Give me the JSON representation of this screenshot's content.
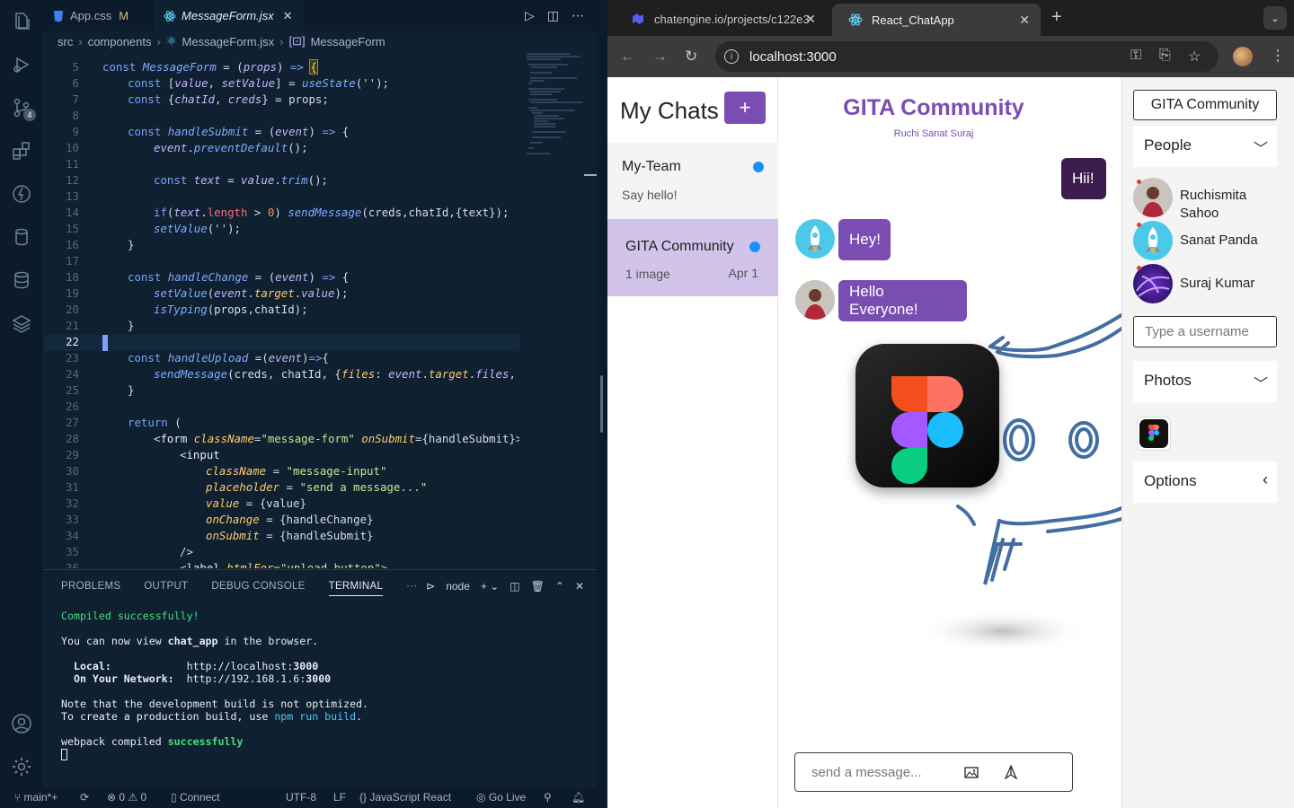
{
  "vscode": {
    "tabs": [
      {
        "label": "App.css",
        "modified": "M"
      },
      {
        "label": "MessageForm.jsx",
        "close": "✕"
      }
    ],
    "breadcrumb": [
      "src",
      "components",
      "MessageForm.jsx",
      "MessageForm"
    ],
    "source_control_badge": "4",
    "line_numbers": [
      "5",
      "6",
      "7",
      "8",
      "9",
      "10",
      "11",
      "12",
      "13",
      "14",
      "15",
      "16",
      "17",
      "18",
      "19",
      "20",
      "21",
      "22",
      "23",
      "24",
      "25",
      "26",
      "27",
      "28",
      "29",
      "30",
      "31",
      "32",
      "33",
      "34",
      "35",
      "36"
    ],
    "current_line": "22",
    "panel_tabs": [
      "PROBLEMS",
      "OUTPUT",
      "DEBUG CONSOLE",
      "TERMINAL"
    ],
    "panel_more": "···",
    "terminal_shell": "node",
    "terminal": {
      "compiled": "Compiled successfully!",
      "view_pre": "You can now view ",
      "app": "chat_app",
      "view_post": " in the browser.",
      "local_label": "  Local:",
      "local_url_pre": "http://localhost:",
      "local_port": "3000",
      "network_label": "  On Your Network:",
      "network_url_pre": "http://192.168.1.6:",
      "network_port": "3000",
      "note1": "Note that the development build is not optimized.",
      "note2_pre": "To create a production build, use ",
      "note2_cmd": "npm run build",
      "note2_post": ".",
      "webpack_pre": "webpack compiled ",
      "webpack_ok": "successfully"
    },
    "status": {
      "branch": "main*+",
      "errors": "0",
      "warnings": "0",
      "connect": "Connect",
      "encoding": "UTF-8",
      "eol": "LF",
      "language": "JavaScript React",
      "golive": "Go Live"
    }
  },
  "browser": {
    "tabs": [
      {
        "title": "chatengine.io/projects/c122e3"
      },
      {
        "title": "React_ChatApp"
      }
    ],
    "url": "localhost:3000"
  },
  "app": {
    "my_chats_title": "My Chats",
    "new_chat": "+",
    "chats": [
      {
        "title": "My-Team",
        "subtitle": "Say hello!",
        "date": ""
      },
      {
        "title": "GITA Community",
        "subtitle": "1 image",
        "date": "Apr 1"
      }
    ],
    "feed_title": "GITA Community",
    "feed_subtitle": "Ruchi Sanat Suraj",
    "messages": [
      {
        "text": "Hii!",
        "mine": true
      },
      {
        "text": "Hey!",
        "mine": false
      },
      {
        "text": "Hello Everyone!",
        "mine": false
      }
    ],
    "message_placeholder": "send a message...",
    "settings": {
      "chat_name": "GITA Community",
      "people_title": "People",
      "people": [
        {
          "name": "Ruchismita Sahoo"
        },
        {
          "name": "Sanat Panda"
        },
        {
          "name": "Suraj Kumar"
        }
      ],
      "username_placeholder": "Type a username",
      "photos_title": "Photos",
      "options_title": "Options"
    }
  }
}
